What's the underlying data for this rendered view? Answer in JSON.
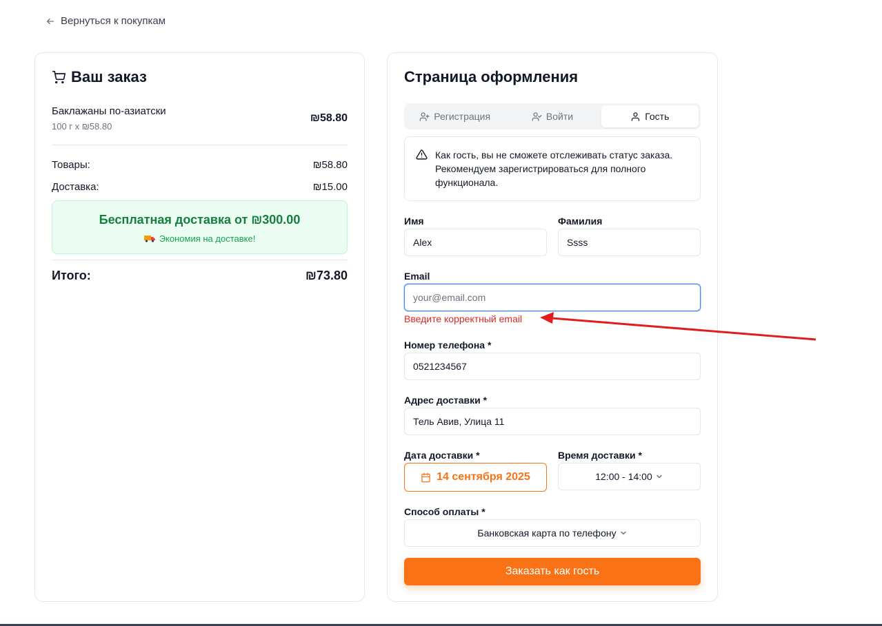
{
  "nav": {
    "back_label": "Вернуться к покупкам"
  },
  "order": {
    "title": "Ваш заказ",
    "items": [
      {
        "name": "Баклажаны по-азиатски",
        "qty": "100 г x ₪58.80",
        "price": "₪58.80"
      }
    ],
    "goods_label": "Товары:",
    "goods_value": "₪58.80",
    "delivery_label": "Доставка:",
    "delivery_value": "₪15.00",
    "free_delivery_title": "Бесплатная доставка от ₪300.00",
    "free_delivery_sub": "Экономия на доставке!",
    "total_label": "Итого:",
    "total_value": "₪73.80"
  },
  "checkout": {
    "title": "Страница оформления",
    "tabs": [
      {
        "label": "Регистрация",
        "icon": "user-plus-icon"
      },
      {
        "label": "Войти",
        "icon": "user-check-icon"
      },
      {
        "label": "Гость",
        "icon": "user-icon"
      }
    ],
    "active_tab": "Гость",
    "guest_notice": "Как гость, вы не сможете отслеживать статус заказа. Рекомендуем зарегистрироваться для полного функционала.",
    "fields": {
      "first_name_label": "Имя",
      "first_name_value": "Alex",
      "last_name_label": "Фамилия",
      "last_name_value": "Ssss",
      "email_label": "Email",
      "email_value": "",
      "email_placeholder": "your@email.com",
      "email_error": "Введите корректный email",
      "phone_label": "Номер телефона *",
      "phone_value": "0521234567",
      "address_label": "Адрес доставки *",
      "address_value": "Тель Авив, Улица 11",
      "date_label": "Дата доставки *",
      "date_value": "14 сентября 2025",
      "time_label": "Время доставки *",
      "time_value": "12:00 - 14:00",
      "payment_label": "Способ оплаты *",
      "payment_value": "Банковская карта по телефону"
    },
    "submit_label": "Заказать как гость"
  },
  "colors": {
    "accent": "#f97316",
    "error": "#dc2626",
    "success": "#15803d",
    "annotation_arrow": "#e11d1d"
  }
}
